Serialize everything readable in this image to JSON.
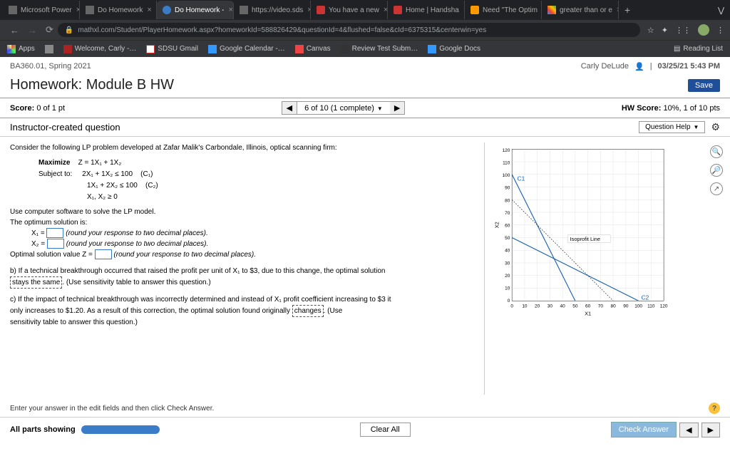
{
  "browser": {
    "tabs": [
      {
        "label": "Microsoft Power"
      },
      {
        "label": "Do Homework"
      },
      {
        "label": "Do Homework -",
        "active": true
      },
      {
        "label": "https://video.sds"
      },
      {
        "label": "You have a new"
      },
      {
        "label": "Home | Handsha"
      },
      {
        "label": "Need \"The Optim"
      },
      {
        "label": "greater than or e"
      }
    ],
    "url": "mathxl.com/Student/PlayerHomework.aspx?homeworkId=588826429&questionId=4&flushed=false&cId=6375315&centerwin=yes",
    "bookmarks": [
      "Apps",
      "",
      "Welcome, Carly -…",
      "SDSU Gmail",
      "Google Calendar -…",
      "Canvas",
      "Review Test Subm…",
      "Google Docs"
    ],
    "reading_list": "Reading List"
  },
  "course": {
    "id": "BA360.01, Spring 2021",
    "user": "Carly DeLude",
    "datetime": "03/25/21 5:43 PM"
  },
  "homework": {
    "title": "Homework: Module B HW",
    "save": "Save",
    "score_label": "Score:",
    "score_value": "0 of 1 pt",
    "nav_text": "6 of 10 (1 complete)",
    "hw_score_label": "HW Score:",
    "hw_score_value": "10%, 1 of 10 pts"
  },
  "question": {
    "type": "Instructor-created question",
    "help": "Question Help",
    "intro": "Consider the following LP problem developed at Zafar Malik's Carbondale, Illinois, optical scanning firm:",
    "lp": {
      "max_label": "Maximize",
      "subj_label": "Subject to:",
      "objective": "Z = 1X₁ + 1X₂",
      "c1": "2X₁ + 1X₂ ≤ 100",
      "c1_tag": "(C₁)",
      "c2": "1X₁ + 2X₂ ≤ 100",
      "c2_tag": "(C₂)",
      "nn": "X₁, X₂ ≥ 0"
    },
    "solve_intro": "Use computer software to solve the LP model.",
    "solve_intro2": "The optimum solution is:",
    "x1_label": "X₁ =",
    "x2_label": "X₂ =",
    "round_hint": "(round your response to two decimal places).",
    "z_label": "Optimal solution value Z =",
    "part_b": "b) If a technical breakthrough occurred that raised the profit per unit of X₁ to $3, due to this change, the optimal solution",
    "stays": "stays the same",
    "sens_hint": ". (Use sensitivity table to answer this question.)",
    "part_c1": "c) If the impact of technical breakthrough was incorrectly determined and instead of X₁ profit coefficient increasing to $3 it",
    "part_c2": "only increases to $1.20. As a result of this correction, the optimal solution found originally",
    "changes": "changes",
    "part_c3": ". (Use",
    "part_c4": "sensitivity table to answer this question.)"
  },
  "footer": {
    "hint": "Enter your answer in the edit fields and then click Check Answer.",
    "all_parts": "All parts showing",
    "clear": "Clear All",
    "check": "Check Answer"
  },
  "chart_data": {
    "type": "line",
    "xlabel": "X1",
    "ylabel": "X2",
    "xlim": [
      0,
      120
    ],
    "ylim": [
      0,
      120
    ],
    "ticks": [
      0,
      10,
      20,
      30,
      40,
      50,
      60,
      70,
      80,
      90,
      100,
      110,
      120
    ],
    "series": [
      {
        "name": "C1",
        "points": [
          [
            0,
            100
          ],
          [
            50,
            0
          ]
        ],
        "color": "#1560b0"
      },
      {
        "name": "C2",
        "points": [
          [
            0,
            50
          ],
          [
            100,
            0
          ]
        ],
        "color": "#1560b0"
      },
      {
        "name": "Isoprofit Line",
        "points": [
          [
            0,
            80
          ],
          [
            80,
            0
          ]
        ],
        "style": "dashed",
        "color": "#333"
      }
    ],
    "annotations": [
      {
        "text": "C1",
        "x": 8,
        "y": 92
      },
      {
        "text": "C2",
        "x": 102,
        "y": 2
      },
      {
        "text": "Isoprofit Line",
        "x": 55,
        "y": 48
      }
    ]
  }
}
